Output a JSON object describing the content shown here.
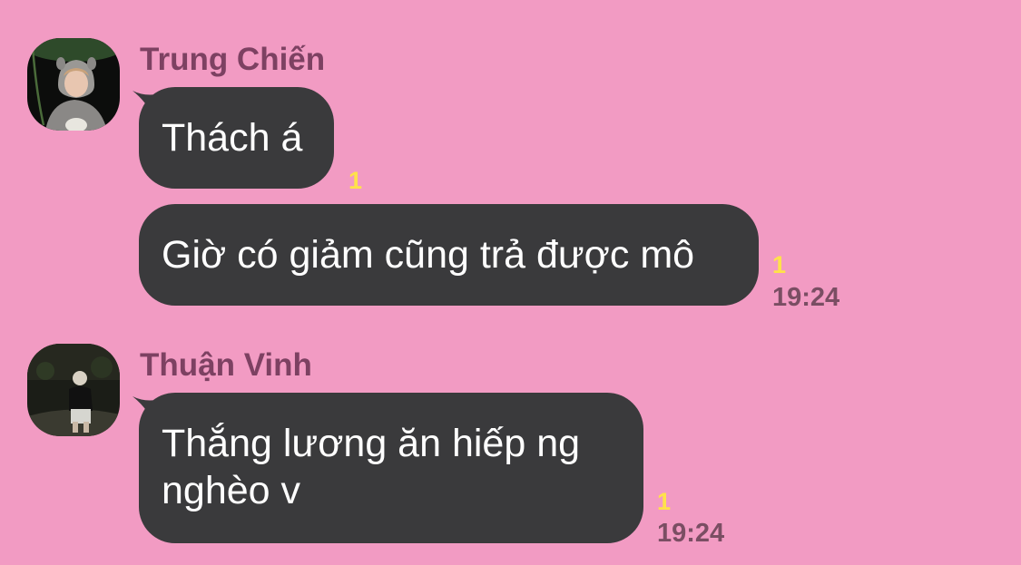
{
  "messages": [
    {
      "sender": "Trung Chiến",
      "avatar_icon": "user-avatar-photo",
      "bubbles": [
        {
          "text": "Thách á",
          "unread": "1",
          "time": ""
        },
        {
          "text": "Giờ có giảm cũng trả được mô",
          "unread": "1",
          "time": "19:24"
        }
      ]
    },
    {
      "sender": "Thuận Vinh",
      "avatar_icon": "user-avatar-photo",
      "bubbles": [
        {
          "line1": "Thắng lương ăn hiếp ng",
          "line2": "nghèo v",
          "unread": "1",
          "time": "19:24"
        }
      ]
    }
  ],
  "colors": {
    "background": "#f29bc3",
    "bubble": "#3a3a3c",
    "bubble_text": "#ffffff",
    "sender_name": "#7d4162",
    "unread_count": "#ffe24a",
    "timestamp": "#7a4e63"
  }
}
